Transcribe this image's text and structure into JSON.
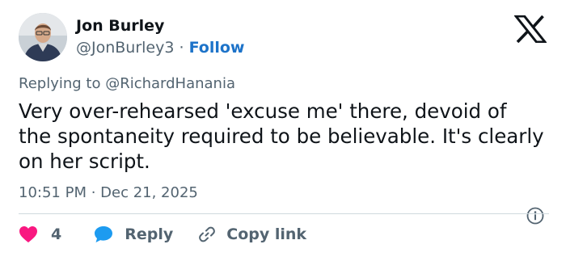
{
  "author": {
    "display_name": "Jon Burley",
    "handle": "@JonBurley3",
    "separator": " · ",
    "follow_label": "Follow"
  },
  "reply_context": {
    "prefix": "Replying to ",
    "mention": "@RichardHanania"
  },
  "tweet": {
    "text": "Very over-rehearsed 'excuse me' there, devoid of the spontaneity required to be believable. It's clearly on her script.",
    "timestamp": "10:51 PM · Dec 21, 2025"
  },
  "actions": {
    "like_count": "4",
    "reply_label": "Reply",
    "copy_link_label": "Copy link"
  },
  "icons": {
    "logo": "x-logo-icon",
    "like": "heart-icon",
    "reply": "speech-bubble-icon",
    "copy": "link-icon",
    "info": "info-icon"
  },
  "colors": {
    "follow": "#1d73c9",
    "like": "#f91880",
    "reply": "#1d9bf0",
    "muted": "#536471",
    "text": "#0f1419"
  }
}
